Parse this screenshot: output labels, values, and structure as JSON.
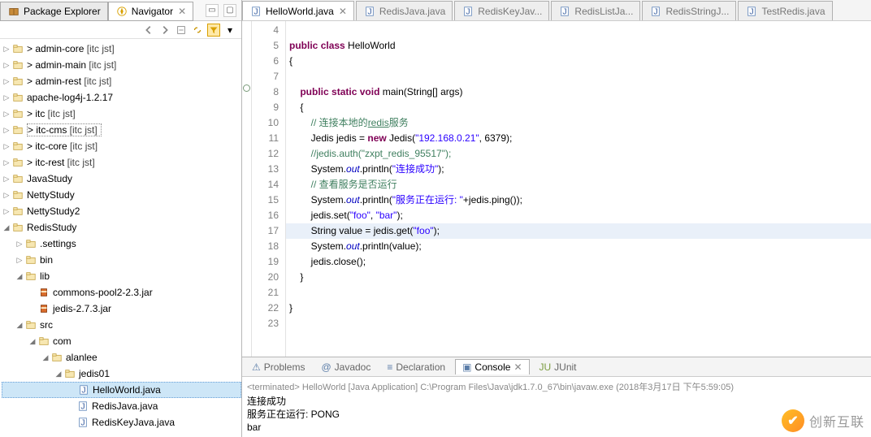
{
  "sidebar": {
    "tabs": [
      {
        "label": "Package Explorer",
        "icon": "package"
      },
      {
        "label": "Navigator",
        "icon": "navigator"
      }
    ],
    "toolbarIcons": [
      "back",
      "fwd",
      "collapse",
      "link",
      "filter",
      "menu"
    ],
    "tree": [
      {
        "depth": 0,
        "arrow": "▷",
        "icon": "proj",
        "label": "> admin-core",
        "decor": "  [itc jst]"
      },
      {
        "depth": 0,
        "arrow": "▷",
        "icon": "proj",
        "label": "> admin-main",
        "decor": "  [itc jst]"
      },
      {
        "depth": 0,
        "arrow": "▷",
        "icon": "proj",
        "label": "> admin-rest",
        "decor": "  [itc jst]"
      },
      {
        "depth": 0,
        "arrow": "▷",
        "icon": "proj",
        "label": "apache-log4j-1.2.17",
        "decor": ""
      },
      {
        "depth": 0,
        "arrow": "▷",
        "icon": "proj",
        "label": "> itc",
        "decor": "  [itc jst]"
      },
      {
        "depth": 0,
        "arrow": "▷",
        "icon": "proj",
        "label": "> itc-cms",
        "decor": "  [itc jst]",
        "boxed": true
      },
      {
        "depth": 0,
        "arrow": "▷",
        "icon": "proj",
        "label": "> itc-core",
        "decor": "  [itc jst]"
      },
      {
        "depth": 0,
        "arrow": "▷",
        "icon": "proj",
        "label": "> itc-rest",
        "decor": "  [itc jst]"
      },
      {
        "depth": 0,
        "arrow": "▷",
        "icon": "proj",
        "label": "JavaStudy",
        "decor": ""
      },
      {
        "depth": 0,
        "arrow": "▷",
        "icon": "proj",
        "label": "NettyStudy",
        "decor": ""
      },
      {
        "depth": 0,
        "arrow": "▷",
        "icon": "proj",
        "label": "NettyStudy2",
        "decor": ""
      },
      {
        "depth": 0,
        "arrow": "◢",
        "icon": "proj",
        "label": "RedisStudy",
        "decor": ""
      },
      {
        "depth": 1,
        "arrow": "▷",
        "icon": "folder",
        "label": ".settings",
        "decor": ""
      },
      {
        "depth": 1,
        "arrow": "▷",
        "icon": "folder",
        "label": "bin",
        "decor": ""
      },
      {
        "depth": 1,
        "arrow": "◢",
        "icon": "folder",
        "label": "lib",
        "decor": ""
      },
      {
        "depth": 2,
        "arrow": " ",
        "icon": "jar",
        "label": "commons-pool2-2.3.jar",
        "decor": ""
      },
      {
        "depth": 2,
        "arrow": " ",
        "icon": "jar",
        "label": "jedis-2.7.3.jar",
        "decor": ""
      },
      {
        "depth": 1,
        "arrow": "◢",
        "icon": "folder",
        "label": "src",
        "decor": ""
      },
      {
        "depth": 2,
        "arrow": "◢",
        "icon": "folder",
        "label": "com",
        "decor": ""
      },
      {
        "depth": 3,
        "arrow": "◢",
        "icon": "folder",
        "label": "alanlee",
        "decor": ""
      },
      {
        "depth": 4,
        "arrow": "◢",
        "icon": "folder",
        "label": "jedis01",
        "decor": ""
      },
      {
        "depth": 5,
        "arrow": " ",
        "icon": "java",
        "label": "HelloWorld.java",
        "decor": "",
        "selected": true
      },
      {
        "depth": 5,
        "arrow": " ",
        "icon": "java",
        "label": "RedisJava.java",
        "decor": ""
      },
      {
        "depth": 5,
        "arrow": " ",
        "icon": "java",
        "label": "RedisKeyJava.java",
        "decor": ""
      }
    ]
  },
  "editor": {
    "tabs": [
      {
        "label": "HelloWorld.java",
        "active": true
      },
      {
        "label": "RedisJava.java",
        "active": false
      },
      {
        "label": "RedisKeyJav...",
        "active": false
      },
      {
        "label": "RedisListJa...",
        "active": false
      },
      {
        "label": "RedisStringJ...",
        "active": false
      },
      {
        "label": "TestRedis.java",
        "active": false
      }
    ],
    "firstLine": 4,
    "highlightLine": 17,
    "lines": [
      {
        "n": 4,
        "html": ""
      },
      {
        "n": 5,
        "html": "<span class='kw'>public</span> <span class='kw'>class</span> HelloWorld"
      },
      {
        "n": 6,
        "html": "{"
      },
      {
        "n": 7,
        "html": ""
      },
      {
        "n": 8,
        "html": "    <span class='kw'>public</span> <span class='kw'>static</span> <span class='kw'>void</span> main(String[] args)"
      },
      {
        "n": 9,
        "html": "    {"
      },
      {
        "n": 10,
        "html": "        <span class='cm'>// 连接本地的<u>redis</u>服务</span>"
      },
      {
        "n": 11,
        "html": "        Jedis jedis = <span class='kw'>new</span> Jedis(<span class='str'>\"192.168.0.21\"</span>, 6379);"
      },
      {
        "n": 12,
        "html": "        <span class='cm'>//jedis.auth(\"zxpt_redis_95517\");</span>"
      },
      {
        "n": 13,
        "html": "        System.<span class='fld'>out</span>.println(<span class='str'>\"连接成功\"</span>);"
      },
      {
        "n": 14,
        "html": "        <span class='cm'>// 查看服务是否运行</span>"
      },
      {
        "n": 15,
        "html": "        System.<span class='fld'>out</span>.println(<span class='str'>\"服务正在运行: \"</span>+jedis.ping());"
      },
      {
        "n": 16,
        "html": "        jedis.set(<span class='str'>\"foo\"</span>, <span class='str'>\"bar\"</span>);"
      },
      {
        "n": 17,
        "html": "        String value = jedis.get(<span class='str'>\"foo\"</span>);"
      },
      {
        "n": 18,
        "html": "        System.<span class='fld'>out</span>.println(value);"
      },
      {
        "n": 19,
        "html": "        jedis.close();"
      },
      {
        "n": 20,
        "html": "    }"
      },
      {
        "n": 21,
        "html": ""
      },
      {
        "n": 22,
        "html": "}"
      },
      {
        "n": 23,
        "html": ""
      }
    ]
  },
  "bottomTabs": [
    {
      "label": "Problems",
      "active": false
    },
    {
      "label": "Javadoc",
      "active": false
    },
    {
      "label": "Declaration",
      "active": false
    },
    {
      "label": "Console",
      "active": true
    },
    {
      "label": "JUnit",
      "active": false
    }
  ],
  "console": {
    "header": "<terminated> HelloWorld [Java Application] C:\\Program Files\\Java\\jdk1.7.0_67\\bin\\javaw.exe (2018年3月17日 下午5:59:05)",
    "lines": [
      "连接成功",
      "服务正在运行: PONG",
      "bar"
    ]
  },
  "watermark": {
    "text": "创新互联"
  }
}
